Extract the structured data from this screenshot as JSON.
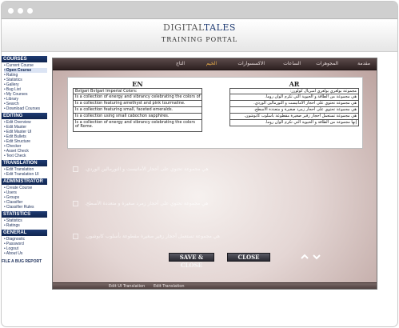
{
  "header": {
    "logo_part1": "DIGITAL",
    "logo_part2": "TALES",
    "subtitle": "TRAINING PORTAL"
  },
  "sidebar": {
    "sections": [
      {
        "title": "COURSES",
        "items": [
          {
            "label": "Current Course",
            "active": false
          },
          {
            "label": "Open Course",
            "active": true
          },
          {
            "label": "Rating",
            "active": false
          },
          {
            "label": "Statistics",
            "active": false
          },
          {
            "label": "Gallery",
            "active": false
          },
          {
            "label": "Bug List",
            "active": false
          },
          {
            "label": "My Courses",
            "active": false
          },
          {
            "label": "Library",
            "active": false
          },
          {
            "label": "Search",
            "active": false
          },
          {
            "label": "Download Courses",
            "active": false
          }
        ]
      },
      {
        "title": "EDITING",
        "items": [
          {
            "label": "Edit Overview"
          },
          {
            "label": "Edit Master"
          },
          {
            "label": "Edit Master UI"
          },
          {
            "label": "Edit Bullets"
          },
          {
            "label": "Edit Structure"
          },
          {
            "label": "Checker"
          },
          {
            "label": "Asset Check"
          },
          {
            "label": "Text Check"
          }
        ]
      },
      {
        "title": "TRANSLATION",
        "items": [
          {
            "label": "Edit Translation"
          },
          {
            "label": "Edit Translation UI"
          }
        ]
      },
      {
        "title": "ADMINISTRATOR",
        "items": [
          {
            "label": "Create Course"
          },
          {
            "label": "Users"
          },
          {
            "label": "Groups"
          },
          {
            "label": "Classifier"
          },
          {
            "label": "Classifier Rules"
          }
        ]
      },
      {
        "title": "STATISTICS",
        "items": [
          {
            "label": "Statistics"
          },
          {
            "label": "Ratings"
          }
        ]
      },
      {
        "title": "GENERAL",
        "items": [
          {
            "label": "Diagnostic"
          },
          {
            "label": "Password"
          },
          {
            "label": "Logout"
          },
          {
            "label": "About Us"
          }
        ]
      }
    ],
    "footer": "FILE A BUG REPORT"
  },
  "nav": {
    "items": [
      "مقدمة",
      "المجوهرات",
      "الساعات",
      "الاكسسوارات",
      "الخيم",
      "التاج"
    ],
    "active_index": 4
  },
  "table": {
    "en_header": "EN",
    "ar_header": "AR",
    "en_rows": [
      "Bvlgari Bvlgari Imperial Colors:",
      "Is a collection of energy and vibrancy celebrating the colors of",
      "Is a collection featuring amethyst and pink tourmaline.",
      "Is a collection featuring small, faceted emeralds.",
      "Is a collection using small cabochon sapphires.",
      "Is a collection of energy and vibrancy celebrating the colors of Rome."
    ],
    "ar_rows": [
      "مجموعة بولغري بولغري امبريال كولورز:",
      "هي مجموعة من الطاقة و الحيوية التي تكرم ألوان روما.",
      "هي مجموعة تحتوي على أحجار الأماتيست و التورمالين الوردي.",
      "هي مجموعة تحتوي على أحجار زمرد صغيرة و متعددة الأسطح.",
      "هي مجموعة تستعمل أحجار زفير صغيرة مقطوعة بأسلوب كابوشون.",
      "إنها مجموعة من الطاقة و الحيوية التي تكرم ألوان روما."
    ]
  },
  "background_items": [
    "هي مجموعة تحتوي على أحجار الأماتيست و التورمالين الوردي.",
    "هي مجموعة تحتوي على أحجار زمرد صغيرة و متعددة الأسطح.",
    "هي مجموعة تستعمل أحجار زفير صغيرة مقطوعة بأسلوب كابوشون."
  ],
  "buttons": {
    "save_close": "SAVE & CLOSE",
    "close": "CLOSE"
  },
  "bottom_links": [
    "Edit UI Translation",
    "Edit Translation"
  ],
  "colors": {
    "sidebar_header": "#1f3b73",
    "nav_bar": "#3b2b2b",
    "nav_active": "#f0b24a",
    "button": "#3a3a44"
  }
}
